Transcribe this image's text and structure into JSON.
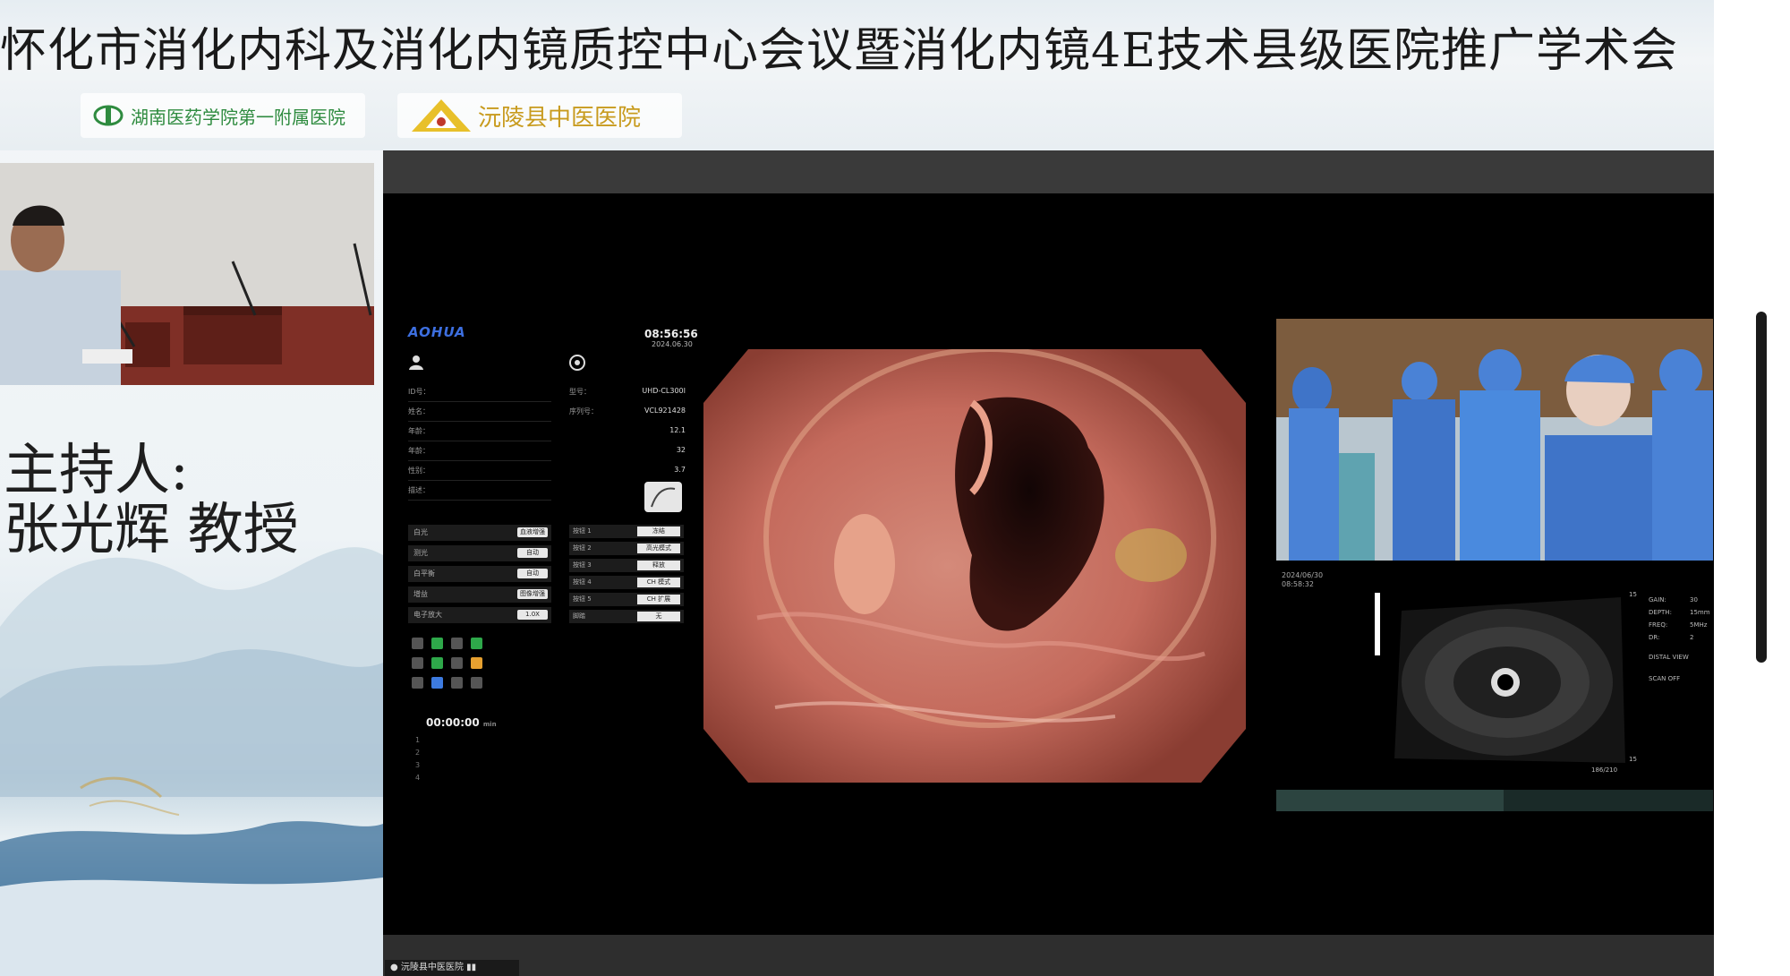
{
  "banner": {
    "title": "怀化市消化内科及消化内镜质控中心会议暨消化内镜4E技术县级医院推广学术会",
    "logo_left_text": "湖南医药学院第一附属医院",
    "logo_right_text": "沅陵县中医医院"
  },
  "host": {
    "label": "主持人:",
    "name": "张光辉 教授"
  },
  "endoscope_ui": {
    "brand": "AOHUA",
    "clock": "08:56:56",
    "date": "2024.06.30",
    "patient_fields": [
      "ID号：",
      "姓名：",
      "年龄：",
      "年龄：",
      "性别：",
      "描述："
    ],
    "device_info": [
      {
        "label": "型号：",
        "value": "UHD-CL300I"
      },
      {
        "label": "序列号：",
        "value": "VCL921428"
      },
      {
        "label": "",
        "value": "12.1"
      },
      {
        "label": "",
        "value": "32"
      },
      {
        "label": "",
        "value": "3.7"
      }
    ],
    "controls": [
      {
        "label": "白光",
        "button": "血液增强"
      },
      {
        "label": "测光",
        "button": "自动"
      },
      {
        "label": "白平衡",
        "button": "自动"
      },
      {
        "label": "增益",
        "button": "图像增强"
      },
      {
        "label": "电子放大",
        "button": "1.0X"
      }
    ],
    "selectors": [
      {
        "label": "按钮 1",
        "button": "冻结"
      },
      {
        "label": "按钮 2",
        "button": "高光模式"
      },
      {
        "label": "按钮 3",
        "button": "释放"
      },
      {
        "label": "按钮 4",
        "button": "CH 模式"
      },
      {
        "label": "按钮 5",
        "button": "CH 扩展"
      },
      {
        "label": "脚踏",
        "button": "无"
      }
    ],
    "timer": "00:00:00",
    "timer_suffix": "min",
    "list_numbers": [
      "1",
      "2",
      "3",
      "4"
    ]
  },
  "or_video": {
    "date": "2024/06/30",
    "time": "08:58:32"
  },
  "ultrasound": {
    "gain_label": "GAIN:",
    "gain_value": "30",
    "depth_label": "DEPTH:",
    "depth_value": "15mm",
    "freq_label": "FREQ:",
    "freq_value": "5MHz",
    "dr_label": "DR:",
    "dr_value": "2",
    "view_label": "DISTAL VIEW",
    "scan_label": "SCAN OFF",
    "scale_top": "15",
    "scale_bottom": "15",
    "frame": "186/210",
    "progress": 0.52
  },
  "status_bar": {
    "text": "沅陵县中医医院"
  },
  "colors": {
    "brand_blue": "#3d6fe0",
    "screen_bg": "#000000",
    "hospital_green": "#2e8b3f",
    "hospital_gold": "#c89b1e"
  }
}
